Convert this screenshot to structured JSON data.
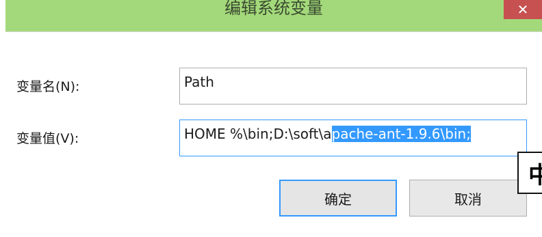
{
  "window": {
    "title": "编辑系统变量",
    "close_label": "✕"
  },
  "form": {
    "name_label": "变量名(N):",
    "name_value": "Path",
    "value_label": "变量值(V):",
    "value_unselected": "HOME %\\bin;D:\\soft\\a",
    "value_selected": "pache-ant-1.9.6\\bin;"
  },
  "buttons": {
    "ok_label": "确定",
    "cancel_label": "取消"
  },
  "ime": {
    "indicator": "中"
  },
  "colors": {
    "titlebar": "#a3d97a",
    "selection": "#3399ff",
    "close_button": "#c75050"
  }
}
